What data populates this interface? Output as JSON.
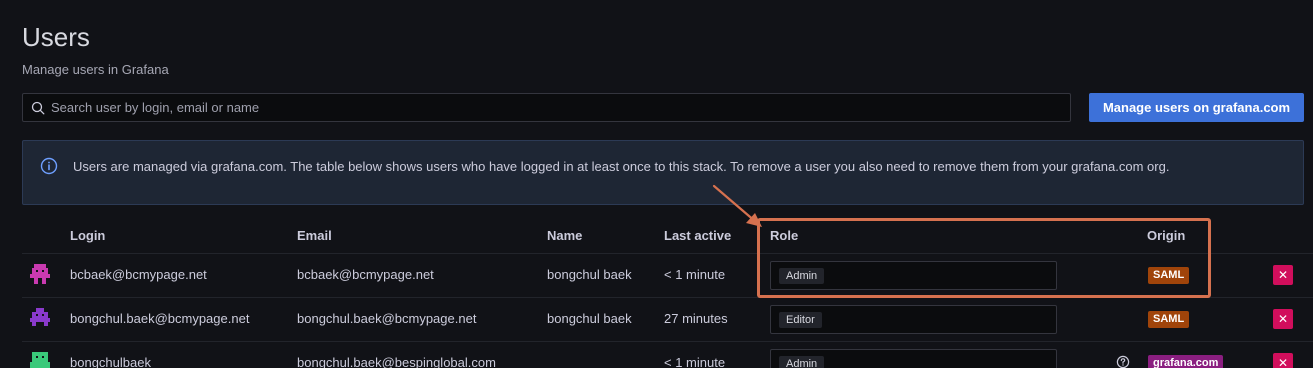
{
  "page": {
    "title": "Users",
    "subtitle": "Manage users in Grafana"
  },
  "search": {
    "placeholder": "Search user by login, email or name"
  },
  "manage_button": {
    "label": "Manage users on grafana.com"
  },
  "alert": {
    "text": "Users are managed via grafana.com. The table below shows users who have logged in at least once to this stack. To remove a user you also need to remove them from your grafana.com org."
  },
  "table": {
    "headers": {
      "login": "Login",
      "email": "Email",
      "name": "Name",
      "last_active": "Last active",
      "role": "Role",
      "origin": "Origin"
    },
    "rows": [
      {
        "login": "bcbaek@bcmypage.net",
        "email": "bcbaek@bcmypage.net",
        "name": "bongchul baek",
        "last_active": "< 1 minute",
        "role": "Admin",
        "origin": "SAML",
        "origin_color": "#a0440a",
        "avatar_color": "#c93ab0",
        "delete_label": "✕"
      },
      {
        "login": "bongchul.baek@bcmypage.net",
        "email": "bongchul.baek@bcmypage.net",
        "name": "bongchul baek",
        "last_active": "27 minutes",
        "role": "Editor",
        "origin": "SAML",
        "origin_color": "#a0440a",
        "avatar_color": "#8a3acb",
        "delete_label": "✕"
      },
      {
        "login": "bongchulbaek",
        "email": "bongchul.baek@bespinglobal.com",
        "name": "",
        "last_active": "< 1 minute",
        "role": "Admin",
        "origin": "grafana.com",
        "origin_color": "#8a1e80",
        "avatar_color": "#3ac97a",
        "delete_label": "✕"
      }
    ]
  },
  "colors": {
    "primary": "#3d71d9",
    "danger": "#d10e5c",
    "annotation": "#d6714f"
  }
}
